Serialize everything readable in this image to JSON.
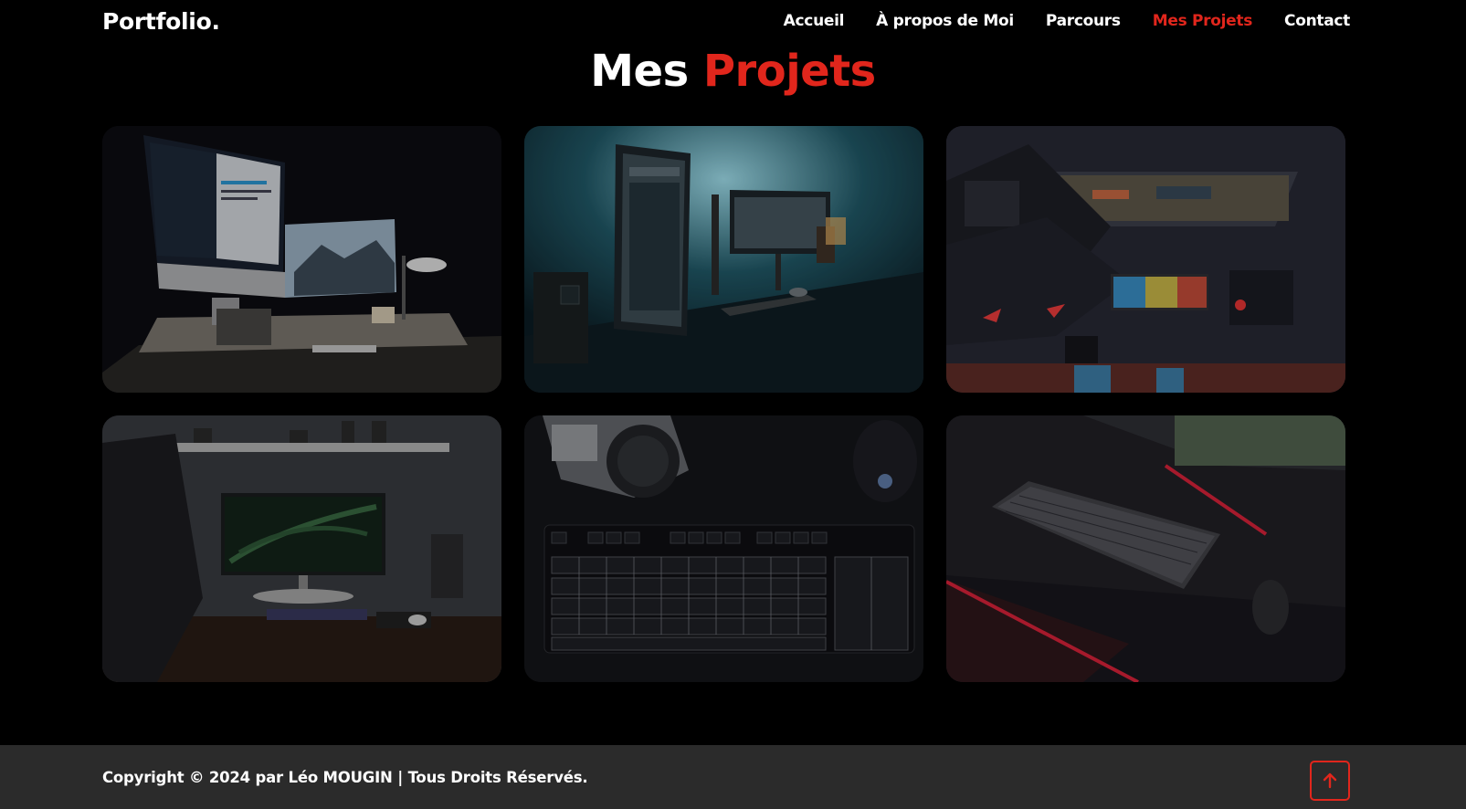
{
  "header": {
    "logo": "Portfolio.",
    "nav": [
      {
        "label": "Accueil"
      },
      {
        "label": "À propos de Moi"
      },
      {
        "label": "Parcours"
      },
      {
        "label": "Mes Projets"
      },
      {
        "label": "Contact"
      }
    ],
    "active_nav": "Mes Projets"
  },
  "section": {
    "title_part1": "Mes",
    "title_part2": "Projets"
  },
  "projects": [
    {
      "image": "desk-setup-imac-monitors"
    },
    {
      "image": "desk-setup-vertical-monitor"
    },
    {
      "image": "desk-setup-top-view-laptop-rgb-keyboard"
    },
    {
      "image": "desk-setup-chair-monitor-shelf"
    },
    {
      "image": "keyboard-camera-mouse"
    },
    {
      "image": "keyboard-mouse-red-desk"
    }
  ],
  "footer": {
    "copyright": "Copyright © 2024 par Léo MOUGIN | Tous Droits Réservés.",
    "top_icon": "arrow-up-icon"
  },
  "colors": {
    "accent": "#e1261c",
    "background": "#000000",
    "footer_bg": "#2b2b2b"
  }
}
